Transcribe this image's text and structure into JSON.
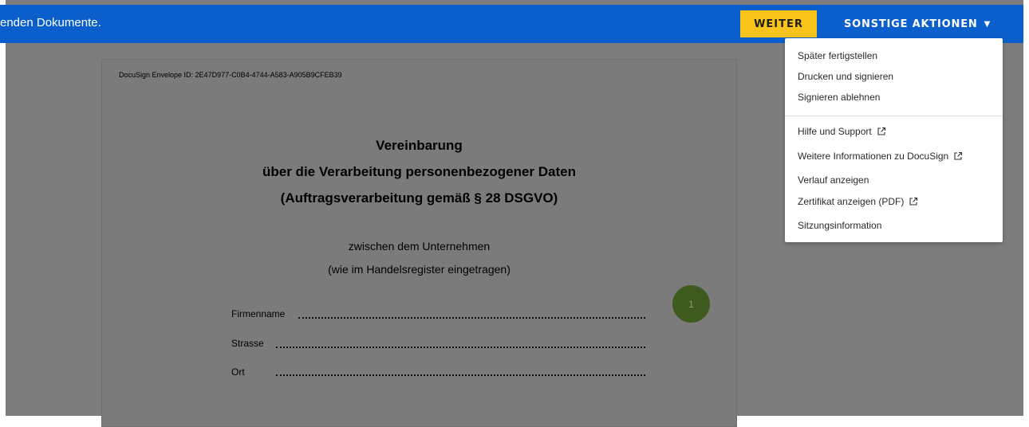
{
  "topbar": {
    "message": "enden Dokumente.",
    "continue_label": "WEITER",
    "actions_label": "SONSTIGE AKTIONEN",
    "actions_caret": "▼"
  },
  "document": {
    "envelope_id": "DocuSign Envelope ID: 2E47D977-C0B4-4744-A583-A905B9CFEB39",
    "title_lines": [
      "Vereinbarung",
      "über die Verarbeitung personenbezogener Daten",
      "(Auftragsverarbeitung gemäß § 28 DSGVO)"
    ],
    "between_lines": [
      "zwischen dem Unternehmen",
      "(wie im Handelsregister eingetragen)"
    ],
    "fields": [
      "Firmenname",
      "Strasse",
      "Ort"
    ],
    "marker_number": "1"
  },
  "menu": {
    "items": [
      {
        "label": "Später fertigstellen"
      },
      {
        "label": "Drucken und signieren"
      },
      {
        "label": "Signieren ablehnen"
      },
      {
        "label": "Hilfe und Support",
        "icon": "external-link-icon"
      },
      {
        "label": "Weitere Informationen zu DocuSign",
        "icon": "external-link-icon"
      },
      {
        "label": "Verlauf anzeigen"
      },
      {
        "label": "Zertifikat anzeigen (PDF)",
        "icon": "external-link-icon"
      },
      {
        "label": "Sitzungsinformation"
      }
    ]
  },
  "colors": {
    "topbar": "#0a5fcc",
    "continue_button": "#f8c41c",
    "overlay": "#7d7d7d",
    "marker": "#3f5a1f"
  }
}
